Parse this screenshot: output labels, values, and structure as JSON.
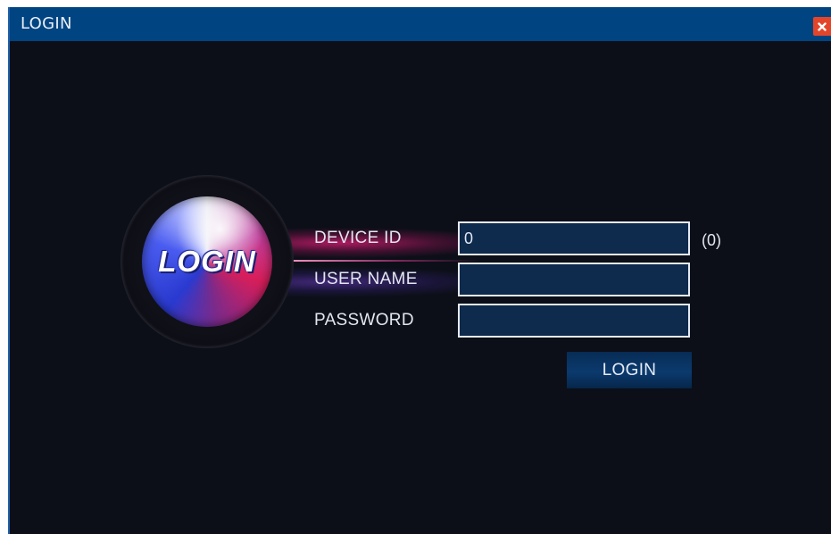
{
  "window": {
    "title": "LOGIN",
    "close_icon": "close-icon",
    "colors": {
      "title_bar": "#004482",
      "background": "#0c0f18",
      "close_button": "#e3452b"
    }
  },
  "emblem": {
    "text": "LOGIN"
  },
  "form": {
    "device_id": {
      "label": "DEVICE ID",
      "value": "0",
      "hint": "(0)"
    },
    "user_name": {
      "label": "USER NAME",
      "value": ""
    },
    "password": {
      "label": "PASSWORD",
      "value": ""
    },
    "submit_label": "LOGIN",
    "colors": {
      "input_background": "#0e2a4c",
      "input_border": "#e6eaf2",
      "button_background": "#0b3a6e"
    }
  }
}
